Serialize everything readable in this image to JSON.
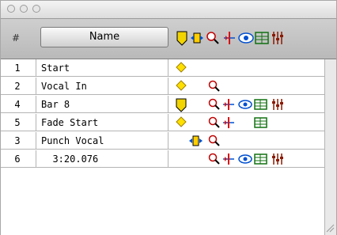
{
  "window": {
    "title": ""
  },
  "header": {
    "num_label": "#",
    "name_label": "Name"
  },
  "icon_colors": {
    "memory": "#f2d400",
    "selection": "#ffcf00",
    "zoom": "#c00000",
    "track_show": "#d81010",
    "track_height": "#0050d0",
    "group": "#107010",
    "auto": "#8a1a00"
  },
  "columns": [
    "marker",
    "selection",
    "zoom",
    "pre_post",
    "track_show",
    "track_height",
    "group",
    "window_config"
  ],
  "rows": [
    {
      "num": "1",
      "name": "Start",
      "icons": [
        "marker"
      ]
    },
    {
      "num": "2",
      "name": "Vocal In",
      "icons": [
        "marker",
        "zoom"
      ]
    },
    {
      "num": "4",
      "name": "Bar 8",
      "icons": [
        "memory",
        "zoom",
        "pre_post",
        "track_show",
        "track_height",
        "auto"
      ]
    },
    {
      "num": "5",
      "name": "Fade Start",
      "icons": [
        "marker",
        "zoom",
        "pre_post",
        "track_height"
      ]
    },
    {
      "num": "3",
      "name": "Punch Vocal",
      "icons": [
        "selection",
        "zoom"
      ]
    },
    {
      "num": "6",
      "name": "  3:20.076",
      "icons": [
        "zoom",
        "pre_post",
        "track_show",
        "track_height",
        "auto"
      ]
    }
  ]
}
